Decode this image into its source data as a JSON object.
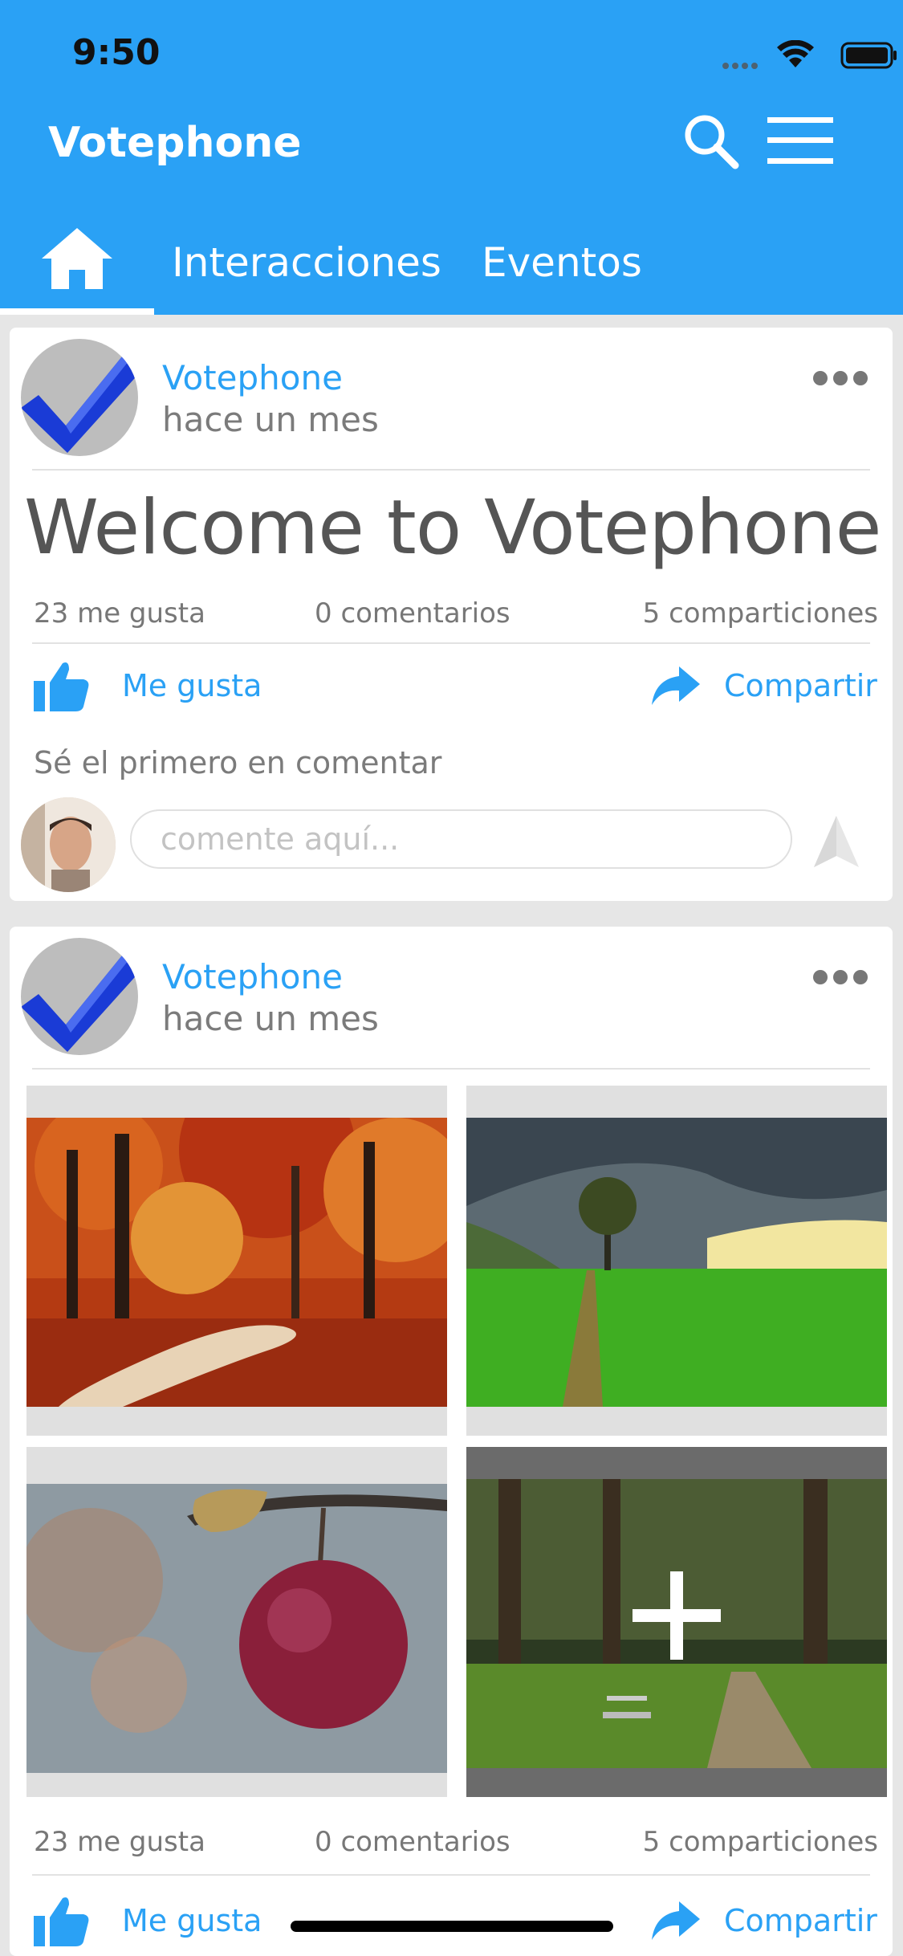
{
  "status_bar": {
    "time": "9:50"
  },
  "app_bar": {
    "title": "Votephone",
    "search_icon": "search-icon",
    "menu_icon": "hamburger-menu-icon"
  },
  "tabs": [
    {
      "icon": "home-icon",
      "active": true
    },
    {
      "label": "Interacciones"
    },
    {
      "label": "Eventos"
    }
  ],
  "posts": [
    {
      "author": "Votephone",
      "time": "hace un mes",
      "title": "Welcome to Votephone",
      "stats": {
        "likes": "23 me gusta",
        "comments": "0 comentarios",
        "shares": "5 comparticiones"
      },
      "actions": {
        "like": "Me gusta",
        "share": "Compartir"
      },
      "first_comment_prompt": "Sé el primero en comentar",
      "comment_placeholder": "comente aquí..."
    },
    {
      "author": "Votephone",
      "time": "hace un mes",
      "images": [
        "autumn-forest-path",
        "green-field-tree",
        "red-apple-branch",
        "forest-park-bench"
      ],
      "more_images_icon": "plus-icon",
      "stats": {
        "likes": "23 me gusta",
        "comments": "0 comentarios",
        "shares": "5 comparticiones"
      },
      "actions": {
        "like": "Me gusta",
        "share": "Compartir"
      }
    }
  ],
  "colors": {
    "accent": "#2aa1f5",
    "logo_blue": "#1a3bd6"
  }
}
